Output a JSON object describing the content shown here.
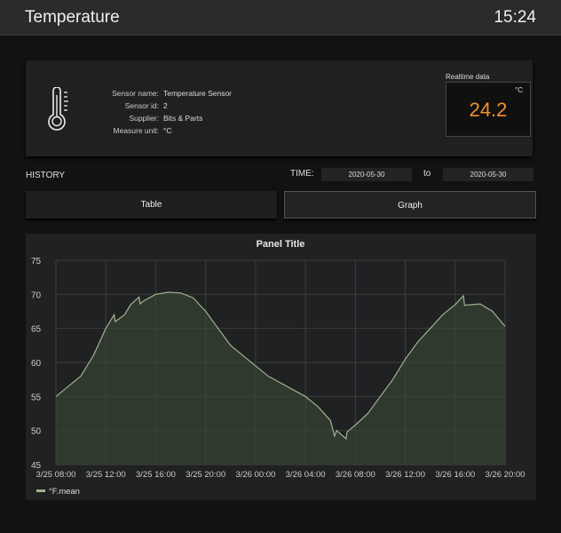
{
  "header": {
    "title": "Temperature",
    "clock": "15:24"
  },
  "sensor": {
    "icon": "thermometer-icon",
    "rows": [
      {
        "label": "Sensor name:",
        "value": "Temperature Sensor"
      },
      {
        "label": "Sensor id:",
        "value": "2"
      },
      {
        "label": "Supplier:",
        "value": "Bits & Parts"
      },
      {
        "label": "Measure unit:",
        "value": "°C"
      }
    ]
  },
  "realtime": {
    "label": "Realtime data",
    "unit": "°C",
    "value": "24.2",
    "color": "#f0922a"
  },
  "history": {
    "label": "HISTORY",
    "time_label": "TIME:",
    "from": "2020-05-30",
    "to_label": "to",
    "to": "2020-05-30"
  },
  "tabs": [
    {
      "label": "Table",
      "active": false
    },
    {
      "label": "Graph",
      "active": true
    }
  ],
  "chart_data": {
    "type": "area",
    "title": "Panel Title",
    "ylim": [
      45,
      75
    ],
    "yticks": [
      75,
      70,
      65,
      60,
      55,
      50,
      45
    ],
    "xticks": [
      "3/25 08:00",
      "3/25 12:00",
      "3/25 16:00",
      "3/25 20:00",
      "3/26 00:00",
      "3/26 04:00",
      "3/26 08:00",
      "3/26 12:00",
      "3/26 16:00",
      "3/26 20:00"
    ],
    "grid": true,
    "legend": "bottom-left",
    "series": [
      {
        "name": "°F.mean",
        "color": "#9fb38f",
        "x": [
          "3/25 08:00",
          "3/25 09:00",
          "3/25 10:00",
          "3/25 10:30",
          "3/25 11:00",
          "3/25 11:30",
          "3/25 12:00",
          "3/25 12:40",
          "3/25 12:45",
          "3/25 13:30",
          "3/25 14:00",
          "3/25 14:40",
          "3/25 14:45",
          "3/25 15:00",
          "3/25 16:00",
          "3/25 17:00",
          "3/25 18:00",
          "3/25 19:00",
          "3/25 20:00",
          "3/25 21:00",
          "3/25 22:00",
          "3/25 23:00",
          "3/26 00:00",
          "3/26 01:00",
          "3/26 02:00",
          "3/26 03:00",
          "3/26 04:00",
          "3/26 05:00",
          "3/26 06:00",
          "3/26 06:20",
          "3/26 06:30",
          "3/26 07:15",
          "3/26 07:20",
          "3/26 08:00",
          "3/26 09:00",
          "3/26 10:00",
          "3/26 11:00",
          "3/26 12:00",
          "3/26 13:00",
          "3/26 14:00",
          "3/26 15:00",
          "3/26 16:00",
          "3/26 16:40",
          "3/26 16:45",
          "3/26 18:00",
          "3/26 19:00",
          "3/26 20:00"
        ],
        "values": [
          55,
          56.5,
          58,
          59.5,
          61,
          63,
          65,
          67,
          66,
          67,
          68.5,
          69.6,
          68.6,
          69,
          70,
          70.3,
          70.2,
          69.5,
          67.5,
          65,
          62.5,
          61,
          59.5,
          58,
          57,
          56,
          55,
          53.5,
          51.5,
          49.2,
          50,
          48.8,
          49.8,
          50.8,
          52.5,
          55,
          57.5,
          60.5,
          63,
          65,
          67,
          68.5,
          69.8,
          68.4,
          68.6,
          67.5,
          65.3
        ]
      }
    ]
  }
}
